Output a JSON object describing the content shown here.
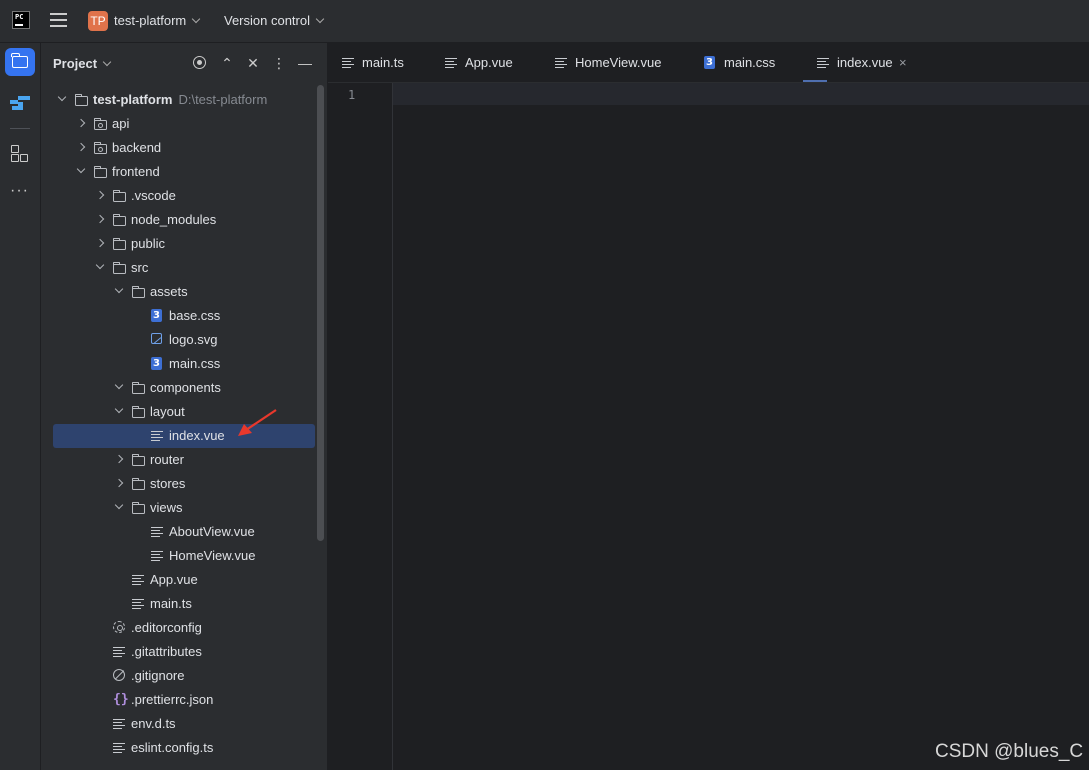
{
  "titlebar": {
    "logo_text": "PC",
    "project_badge": "TP",
    "project_name": "test-platform",
    "version_control": "Version control"
  },
  "panel": {
    "title": "Project"
  },
  "tree": [
    {
      "label": "test-platform",
      "path": "D:\\test-platform",
      "icon": "folder-icon",
      "toggle": "open",
      "level": 0,
      "bold": true
    },
    {
      "label": "api",
      "icon": "module-folder-icon",
      "toggle": "closed",
      "level": 1
    },
    {
      "label": "backend",
      "icon": "module-folder-icon",
      "toggle": "closed",
      "level": 1
    },
    {
      "label": "frontend",
      "icon": "folder-icon",
      "toggle": "open",
      "level": 1
    },
    {
      "label": ".vscode",
      "icon": "folder-icon",
      "toggle": "closed",
      "level": 2
    },
    {
      "label": "node_modules",
      "icon": "folder-icon",
      "toggle": "closed",
      "level": 2
    },
    {
      "label": "public",
      "icon": "folder-icon",
      "toggle": "closed",
      "level": 2
    },
    {
      "label": "src",
      "icon": "folder-icon",
      "toggle": "open",
      "level": 2
    },
    {
      "label": "assets",
      "icon": "folder-icon",
      "toggle": "open",
      "level": 3
    },
    {
      "label": "base.css",
      "icon": "css-file-icon",
      "level": 4
    },
    {
      "label": "logo.svg",
      "icon": "image-file-icon",
      "level": 4
    },
    {
      "label": "main.css",
      "icon": "css-file-icon",
      "level": 4
    },
    {
      "label": "components",
      "icon": "folder-icon",
      "toggle": "open",
      "level": 3
    },
    {
      "label": "layout",
      "icon": "folder-icon",
      "toggle": "open",
      "level": 3
    },
    {
      "label": "index.vue",
      "icon": "text-file-icon",
      "level": 4,
      "selected": true
    },
    {
      "label": "router",
      "icon": "folder-icon",
      "toggle": "closed",
      "level": 3
    },
    {
      "label": "stores",
      "icon": "folder-icon",
      "toggle": "closed",
      "level": 3
    },
    {
      "label": "views",
      "icon": "folder-icon",
      "toggle": "open",
      "level": 3
    },
    {
      "label": "AboutView.vue",
      "icon": "text-file-icon",
      "level": 4
    },
    {
      "label": "HomeView.vue",
      "icon": "text-file-icon",
      "level": 4
    },
    {
      "label": "App.vue",
      "icon": "text-file-icon",
      "level": 3
    },
    {
      "label": "main.ts",
      "icon": "text-file-icon",
      "level": 3
    },
    {
      "label": ".editorconfig",
      "icon": "settings-gear-icon",
      "level": 2
    },
    {
      "label": ".gitattributes",
      "icon": "text-file-icon",
      "level": 2
    },
    {
      "label": ".gitignore",
      "icon": "ignore-file-icon",
      "level": 2
    },
    {
      "label": ".prettierrc.json",
      "icon": "json-file-icon",
      "level": 2
    },
    {
      "label": "env.d.ts",
      "icon": "text-file-icon",
      "level": 2
    },
    {
      "label": "eslint.config.ts",
      "icon": "text-file-icon",
      "level": 2
    }
  ],
  "tabs": [
    {
      "label": "main.ts",
      "icon": "text-file-icon"
    },
    {
      "label": "App.vue",
      "icon": "text-file-icon"
    },
    {
      "label": "HomeView.vue",
      "icon": "text-file-icon"
    },
    {
      "label": "main.css",
      "icon": "css-file-icon"
    },
    {
      "label": "index.vue",
      "icon": "text-file-icon",
      "active": true,
      "close": "×"
    }
  ],
  "editor": {
    "line_numbers": [
      "1"
    ]
  },
  "watermark": "CSDN @blues_C",
  "colors": {
    "accent": "#3574f0",
    "selection": "#2e436e",
    "badge": "#e0734b",
    "arrow": "#e8382c"
  }
}
